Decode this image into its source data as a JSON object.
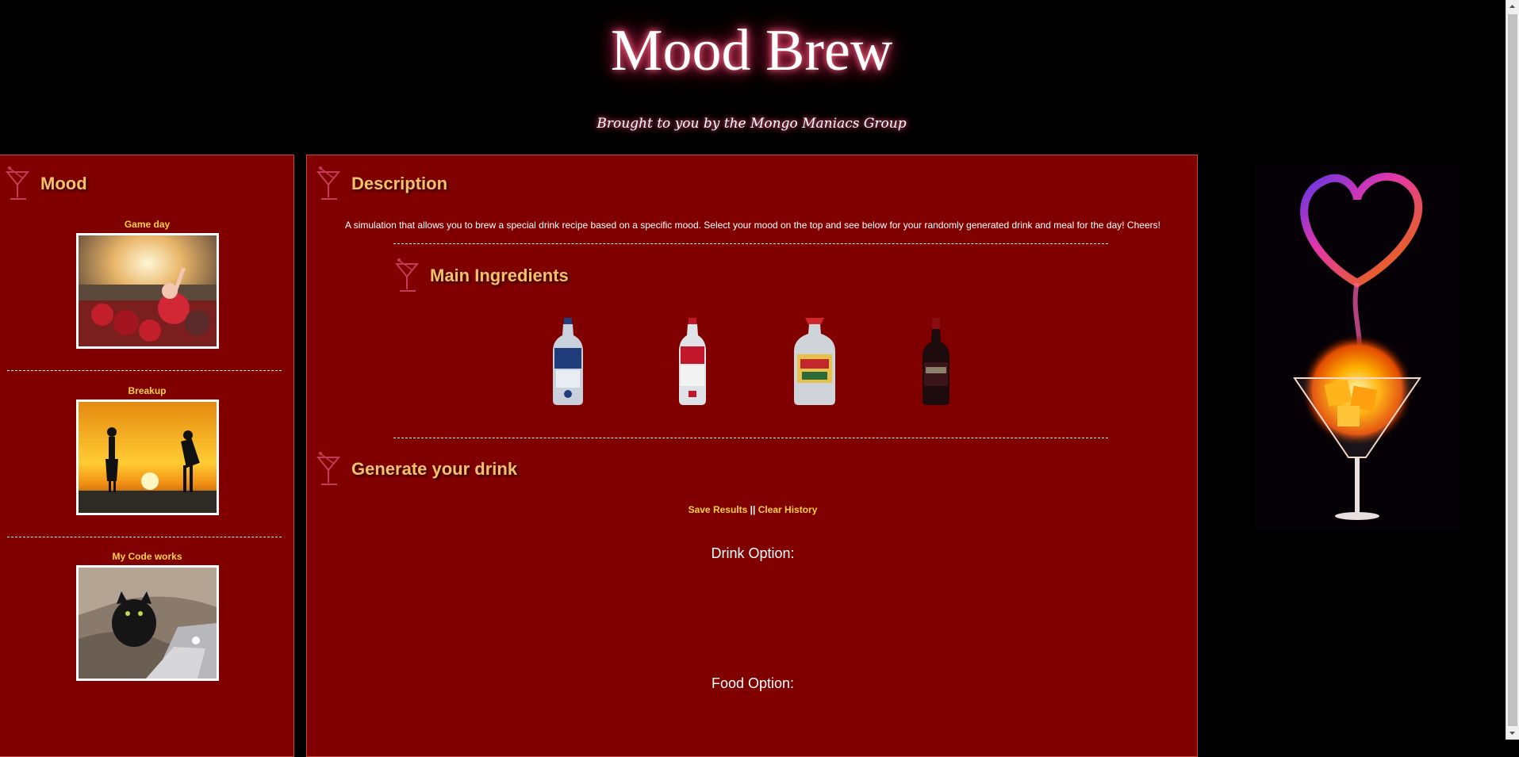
{
  "header": {
    "title": "Mood Brew",
    "subtitle": "Brought to you by the Mongo Maniacs Group"
  },
  "mood_panel": {
    "heading": "Mood",
    "items": [
      {
        "label": "Game day",
        "image": "stadium-fans-photo"
      },
      {
        "label": "Breakup",
        "image": "sunset-couple-silhouette-photo"
      },
      {
        "label": "My Code works",
        "image": "cat-with-laptop-photo"
      }
    ]
  },
  "main": {
    "description_heading": "Description",
    "description_text": "A simulation that allows you to brew a special drink recipe based on a specific mood. Select your mood on the top and see below for your randomly generated drink and meal for the day! Cheers!",
    "ingredients_heading": "Main Ingredients",
    "ingredients": [
      {
        "name": "vodka-bottle-blue-label"
      },
      {
        "name": "vodka-bottle-red-label"
      },
      {
        "name": "tequila-bottle"
      },
      {
        "name": "rum-bottle"
      }
    ],
    "generate_heading": "Generate your drink",
    "save_link": "Save Results",
    "separator": "||",
    "clear_link": "Clear History",
    "drink_label": "Drink Option:",
    "food_label": "Food Option:"
  },
  "side_art": {
    "image": "flaming-heart-cocktail-art"
  },
  "colors": {
    "panel_bg": "#800000",
    "heading": "#f5c06b",
    "link": "#ffd23f",
    "page_bg": "#000000"
  }
}
